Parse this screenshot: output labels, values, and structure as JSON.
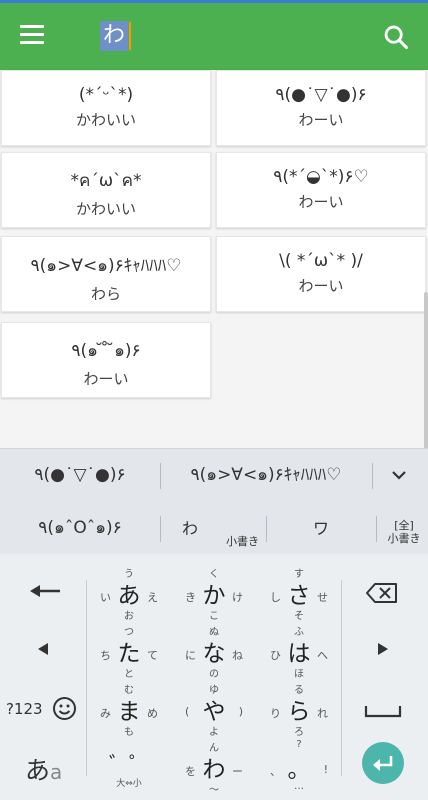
{
  "appbar": {
    "query": "わ",
    "menu_icon": "menu-icon",
    "search_icon": "search-icon",
    "color": "#4caf50"
  },
  "results": [
    {
      "kaomoji": "(*´ᵕ`*)",
      "reading": "かわいい"
    },
    {
      "kaomoji": "٩(●˙▽˙●)۶",
      "reading": "わーい"
    },
    {
      "kaomoji": "*ค´ω`ค*",
      "reading": "かわいい"
    },
    {
      "kaomoji": "٩(*´◒`*)۶♡",
      "reading": "わーい"
    },
    {
      "kaomoji": "٩(๑>∀<๑)۶ｷｬﾊﾊﾊ♡",
      "reading": "わら"
    },
    {
      "kaomoji": "\\( *´ω`* )/",
      "reading": "わーい"
    },
    {
      "kaomoji": "٩(๑ ̆ ̊ ̆๑)۶",
      "reading": "わーい"
    }
  ],
  "keyboard": {
    "candidates_row1": [
      "٩(●˙▽˙●)۶",
      "٩(๑>∀<๑)۶ｷｬﾊﾊﾊ♡"
    ],
    "candidates_row2": [
      "٩(๑ˆOˆ๑)۶",
      "わ",
      "ワ",
      "[全]"
    ],
    "small_write_label": "小書き",
    "full_small_label": "小書き",
    "expand_icon": "chevron-down-icon",
    "keys": {
      "a": {
        "c": "あ",
        "t": "う",
        "l": "い",
        "r": "え",
        "b": "お"
      },
      "ka": {
        "c": "か",
        "t": "く",
        "l": "き",
        "r": "け",
        "b": "こ"
      },
      "sa": {
        "c": "さ",
        "t": "す",
        "l": "し",
        "r": "せ",
        "b": "そ"
      },
      "ta": {
        "c": "た",
        "t": "つ",
        "l": "ち",
        "r": "て",
        "b": "と"
      },
      "na": {
        "c": "な",
        "t": "ぬ",
        "l": "に",
        "r": "ね",
        "b": "の"
      },
      "ha": {
        "c": "は",
        "t": "ふ",
        "l": "ひ",
        "r": "へ",
        "b": "ほ"
      },
      "ma": {
        "c": "ま",
        "t": "む",
        "l": "み",
        "r": "め",
        "b": "も"
      },
      "ya": {
        "c": "や",
        "t": "ゆ",
        "l": "(",
        "r": ")",
        "b": "よ"
      },
      "ra": {
        "c": "ら",
        "t": "る",
        "l": "り",
        "r": "れ",
        "b": "ろ"
      },
      "wa": {
        "c": "わ",
        "t": "ん",
        "l": "を",
        "r": "ー",
        "b": "〜"
      },
      "punct": {
        "c": "。",
        "t": "?",
        "l": "、",
        "r": "!",
        "b": "…"
      }
    },
    "dakuten": "゛゜",
    "dakuten_sub": "大⇔小",
    "num_label": "?123",
    "emoji_icon": "smiley-icon",
    "mode_label": "あ",
    "mode_sub": "a",
    "backspace_icon": "backspace-icon",
    "undo_icon": "undo-arrow-icon",
    "left_icon": "left-arrow-icon",
    "right_icon": "right-arrow-icon",
    "space_icon": "space-icon",
    "enter_icon": "enter-icon",
    "enter_color": "#4db6ac"
  }
}
